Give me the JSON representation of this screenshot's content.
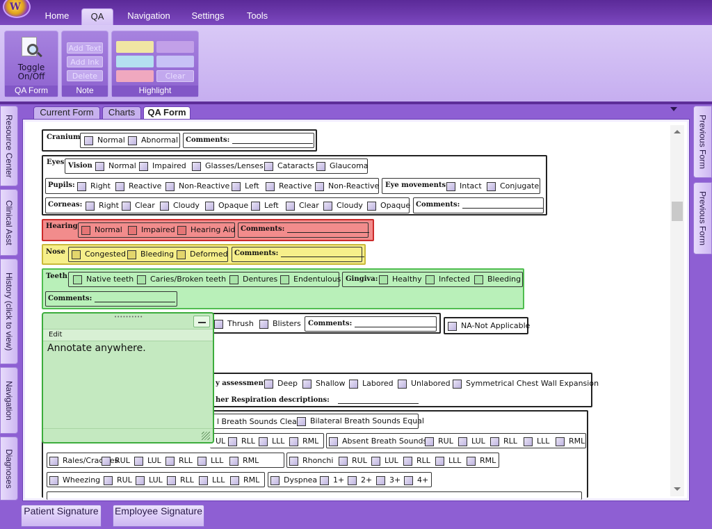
{
  "ribbon_tabs": [
    "Home",
    "QA",
    "Navigation",
    "Settings",
    "Tools"
  ],
  "ribbon": {
    "qa_form_group": {
      "button": "Toggle\nOn/Off",
      "label": "QA Form"
    },
    "note_group": {
      "add_text": "Add Text",
      "add_ink": "Add Ink",
      "delete": "Delete",
      "label": "Note"
    },
    "highlight_group": {
      "clear": "Clear",
      "label": "Highlight",
      "colors": [
        "#f4eda6",
        "#b1e1f0",
        "#f3a9c0",
        "#d4b8ef",
        "#c9c4f7"
      ]
    }
  },
  "doc_tabs": [
    "Current Form",
    "Charts",
    "QA Form"
  ],
  "left_side_tabs": [
    "Resource Center",
    "Clinical Asst",
    "History (click to view)",
    "Navigation",
    "Diagnoses"
  ],
  "right_side_tabs": [
    "Previous Form",
    "Previous Form"
  ],
  "form": {
    "cranium": {
      "label": "Cranium",
      "options": [
        "Normal",
        "Abnormal"
      ],
      "comments": "Comments:"
    },
    "eyes": {
      "label": "Eyes",
      "vision_label": "Vision",
      "vision": [
        "Normal",
        "Impaired",
        "Glasses/Lenses",
        "Cataracts",
        "Glaucoma"
      ],
      "pupils_label": "Pupils:",
      "pupils": [
        "Right",
        "Reactive",
        "Non-Reactive",
        "Left",
        "Reactive",
        "Non-Reactive"
      ],
      "movements_label": "Eye movements:",
      "movements": [
        "Intact",
        "Conjugate"
      ],
      "corneas_label": "Corneas:",
      "corneas": [
        "Right",
        "Clear",
        "Cloudy",
        "Opaque",
        "Left",
        "Clear",
        "Cloudy",
        "Opaque"
      ],
      "comments": "Comments:"
    },
    "hearing": {
      "label": "Hearing",
      "options": [
        "Normal",
        "Impaired",
        "Hearing Aid"
      ],
      "comments": "Comments:"
    },
    "nose": {
      "label": "Nose",
      "options": [
        "Congested",
        "Bleeding",
        "Deformed"
      ],
      "comments": "Comments:"
    },
    "teeth": {
      "label": "Teeth",
      "options": [
        "Native teeth",
        "Caries/Broken teeth",
        "Dentures",
        "Endentulous"
      ],
      "comments": "Comments:"
    },
    "gingiva": {
      "label": "Gingiva:",
      "options": [
        "Healthy",
        "Infected",
        "Bleeding"
      ]
    },
    "mouth": {
      "options": [
        "Thrush",
        "Blisters"
      ],
      "comments": "Comments:",
      "na": "NA-Not Applicable"
    },
    "respiratory": {
      "assessment_label": "y assessment:",
      "assessment": [
        "Deep",
        "Shallow",
        "Labored",
        "Unlabored",
        "Symmetrical Chest Wall Expansion"
      ],
      "other_label": "her Respiration descriptions:"
    },
    "breath": {
      "clear": "l Breath Sounds Clear",
      "equal": "Bilateral Breath Sounds Equal",
      "row1_left": [
        "UL",
        "RLL",
        "LLL",
        "RML"
      ],
      "absent_label": "Absent Breath Sounds",
      "absent": [
        "RUL",
        "LUL",
        "RLL",
        "LLL",
        "RML"
      ],
      "rales_label": "Rales/Crackles",
      "rales": [
        "RUL",
        "LUL",
        "RLL",
        "LLL",
        "RML"
      ],
      "rhonchi_label": "Rhonchi",
      "rhonchi": [
        "RUL",
        "LUL",
        "RLL",
        "LLL",
        "RML"
      ],
      "wheezing_label": "Wheezing",
      "wheezing": [
        "RUL",
        "LUL",
        "RLL",
        "LLL",
        "RML"
      ],
      "dyspnea_label": "Dyspnea",
      "dyspnea": [
        "1+",
        "2+",
        "3+",
        "4+"
      ]
    }
  },
  "note": {
    "menu": "Edit",
    "text": "Annotate anywhere."
  },
  "bottom_buttons": [
    "Patient Signature",
    "Employee Signature"
  ]
}
